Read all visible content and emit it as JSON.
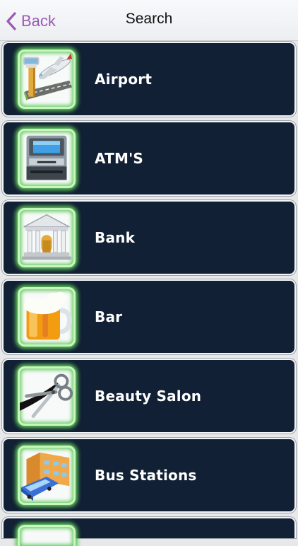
{
  "header": {
    "back_label": "Back",
    "title": "Search"
  },
  "colors": {
    "accent": "#9b59b6",
    "row_background": "#112034",
    "icon_glow": "#62c85a"
  },
  "categories": [
    {
      "label": "Airport",
      "icon": "airport-icon"
    },
    {
      "label": "ATM'S",
      "icon": "atm-icon"
    },
    {
      "label": "Bank",
      "icon": "bank-icon"
    },
    {
      "label": "Bar",
      "icon": "beer-mug-icon"
    },
    {
      "label": "Beauty Salon",
      "icon": "scissors-icon"
    },
    {
      "label": "Bus Stations",
      "icon": "bus-station-icon"
    }
  ]
}
